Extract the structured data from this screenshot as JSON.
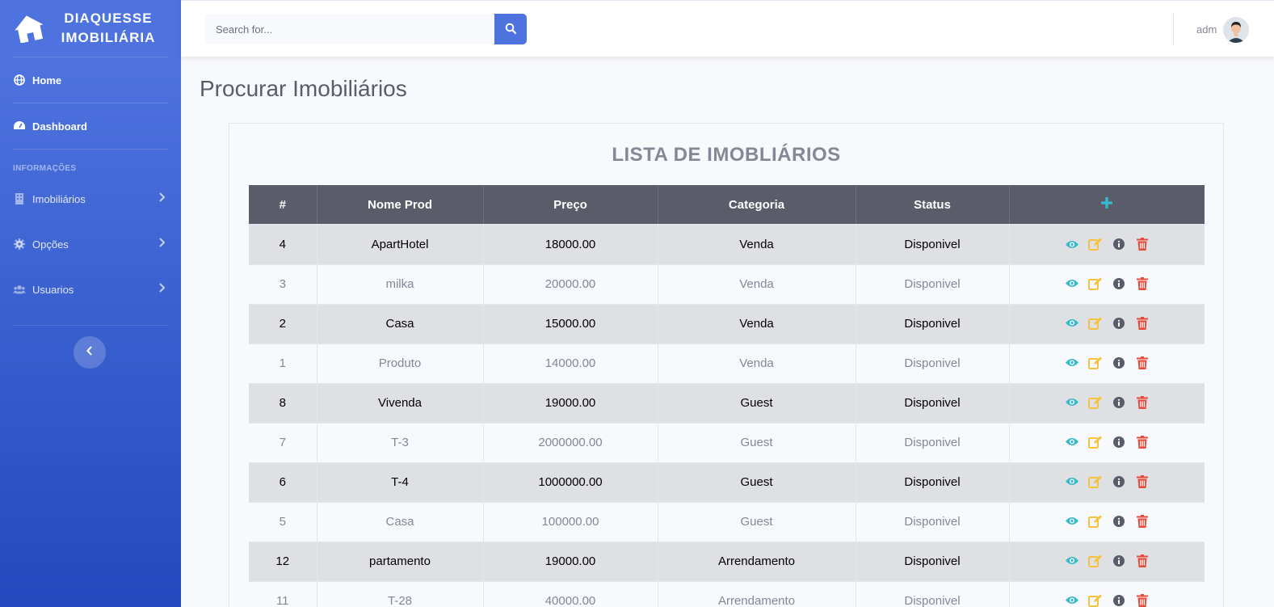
{
  "brand": {
    "line1": "DIAQUESSE",
    "line2": "IMOBILIÁRIA"
  },
  "sidebar": {
    "items": [
      {
        "label": "Home",
        "icon": "globe-icon"
      },
      {
        "label": "Dashboard",
        "icon": "tachometer-icon"
      }
    ],
    "heading": "INFORMAÇÕES",
    "sub_items": [
      {
        "label": "Imobiliários",
        "icon": "building-icon"
      },
      {
        "label": "Opções",
        "icon": "gear-icon"
      },
      {
        "label": "Usuarios",
        "icon": "users-icon"
      }
    ]
  },
  "topbar": {
    "search_placeholder": "Search for...",
    "user_name": "adm"
  },
  "main": {
    "page_title": "Procurar Imobiliários",
    "card_title": "LISTA DE IMOBLIÁRIOS",
    "columns": [
      "#",
      "Nome Prod",
      "Preço",
      "Categoria",
      "Status",
      "+"
    ],
    "rows": [
      {
        "id": "4",
        "name": "ApartHotel",
        "price": "18000.00",
        "category": "Venda",
        "status": "Disponivel"
      },
      {
        "id": "3",
        "name": "milka",
        "price": "20000.00",
        "category": "Venda",
        "status": "Disponivel"
      },
      {
        "id": "2",
        "name": "Casa",
        "price": "15000.00",
        "category": "Venda",
        "status": "Disponivel"
      },
      {
        "id": "1",
        "name": "Produto",
        "price": "14000.00",
        "category": "Venda",
        "status": "Disponivel"
      },
      {
        "id": "8",
        "name": "Vivenda",
        "price": "19000.00",
        "category": "Guest",
        "status": "Disponivel"
      },
      {
        "id": "7",
        "name": "T-3",
        "price": "2000000.00",
        "category": "Guest",
        "status": "Disponivel"
      },
      {
        "id": "6",
        "name": "T-4",
        "price": "1000000.00",
        "category": "Guest",
        "status": "Disponivel"
      },
      {
        "id": "5",
        "name": "Casa",
        "price": "100000.00",
        "category": "Guest",
        "status": "Disponivel"
      },
      {
        "id": "12",
        "name": "partamento",
        "price": "19000.00",
        "category": "Arrendamento",
        "status": "Disponivel"
      },
      {
        "id": "11",
        "name": "T-28",
        "price": "40000.00",
        "category": "Arrendamento",
        "status": "Disponivel"
      }
    ]
  },
  "colors": {
    "primary": "#4e73df",
    "view": "#36b9cc",
    "edit": "#f6c23e",
    "info": "#5a5c69",
    "delete": "#e74a3b"
  }
}
